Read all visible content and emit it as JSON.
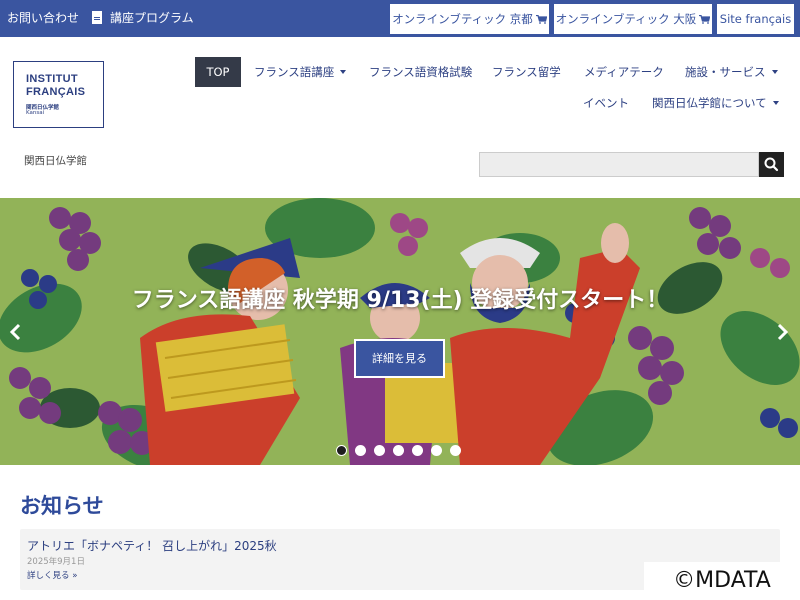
{
  "topbar": {
    "contact": "お問い合わせ",
    "program": "講座プログラム",
    "shop_kyoto": "オンラインブティック 京都",
    "shop_osaka": "オンラインブティック 大阪",
    "site_fr": "Site français"
  },
  "logo": {
    "line1": "INSTITUT",
    "line2": "FRANÇAIS",
    "line3": "関西日仏学館",
    "line4": "Kansai"
  },
  "nav": {
    "top": "TOP",
    "courses": "フランス語講座",
    "exams": "フランス語資格試験",
    "study": "フランス留学",
    "media": "メディアテーク",
    "facilities": "施設・サービス",
    "events": "イベント",
    "about": "関西日仏学館について"
  },
  "breadcrumb": "関西日仏学館",
  "search": {
    "value": "",
    "placeholder": ""
  },
  "hero": {
    "title": "フランス語講座 秋学期 9/13(土) 登録受付スタート！",
    "button": "詳細を見る",
    "slide_count": 7,
    "active_slide": 1
  },
  "news": {
    "heading": "お知らせ",
    "items": [
      {
        "title": "アトリエ「ボナペティ！ 召し上がれ」2025秋",
        "date": "2025年9月1日",
        "more": "詳しく見る »"
      }
    ]
  },
  "watermark": "©MDATA",
  "colors": {
    "brand_blue": "#3a55a0",
    "nav_text": "#2e4183",
    "heading_blue": "#2e4a9a",
    "top_active": "#343a48"
  },
  "icons": [
    "pdf-icon",
    "cart-icon",
    "search-icon",
    "chevron-left-icon",
    "chevron-right-icon"
  ]
}
